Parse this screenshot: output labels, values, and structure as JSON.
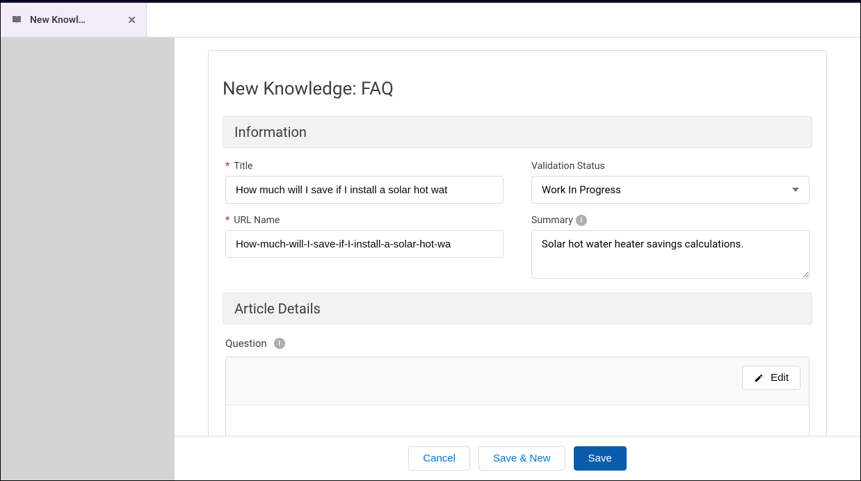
{
  "tab": {
    "label": "New Knowl…",
    "close_glyph": "✕"
  },
  "page": {
    "title": "New Knowledge: FAQ"
  },
  "sections": {
    "information": "Information",
    "article_details": "Article Details"
  },
  "fields": {
    "title": {
      "label": "Title",
      "value": "How much will I save if I install a solar hot wat"
    },
    "url_name": {
      "label": "URL Name",
      "value": "How-much-will-I-save-if-I-install-a-solar-hot-wa"
    },
    "validation_status": {
      "label": "Validation Status",
      "value": "Work In Progress"
    },
    "summary": {
      "label": "Summary",
      "value": "Solar hot water heater savings calculations."
    },
    "question": {
      "label": "Question"
    }
  },
  "buttons": {
    "edit": "Edit",
    "cancel": "Cancel",
    "save_new": "Save & New",
    "save": "Save"
  },
  "info_glyph": "i"
}
